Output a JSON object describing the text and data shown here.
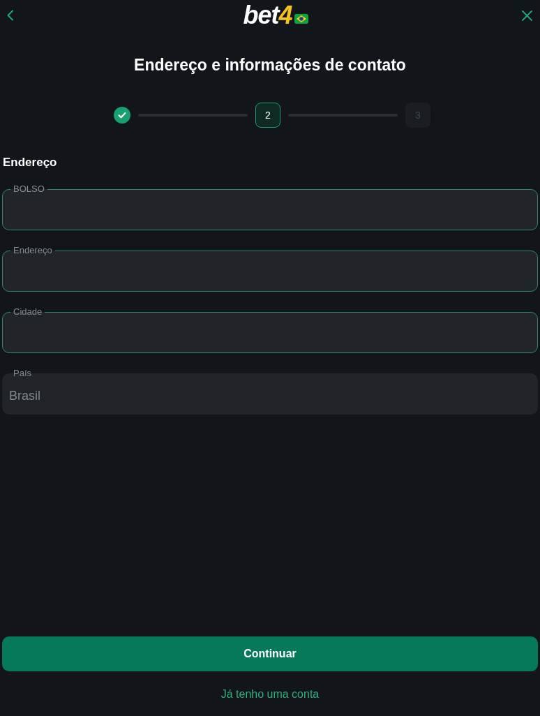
{
  "logo": {
    "text": "bet",
    "accent": "4"
  },
  "title": "Endereço e informações de contato",
  "steps": [
    {
      "completed": true,
      "selected": false
    },
    {
      "label": "2",
      "completed": false,
      "selected": true
    },
    {
      "label": "3",
      "completed": false,
      "selected": false
    }
  ],
  "section_title": "Endereço",
  "fields": [
    {
      "label": "BOLSO",
      "disabled": false
    },
    {
      "label": "Endereço",
      "disabled": false
    },
    {
      "label": "Cidade",
      "disabled": false
    },
    {
      "label": "País",
      "value": "Brasil",
      "disabled": true
    }
  ],
  "primary_button": "Continuar",
  "secondary_link": "Já tenho uma conta"
}
